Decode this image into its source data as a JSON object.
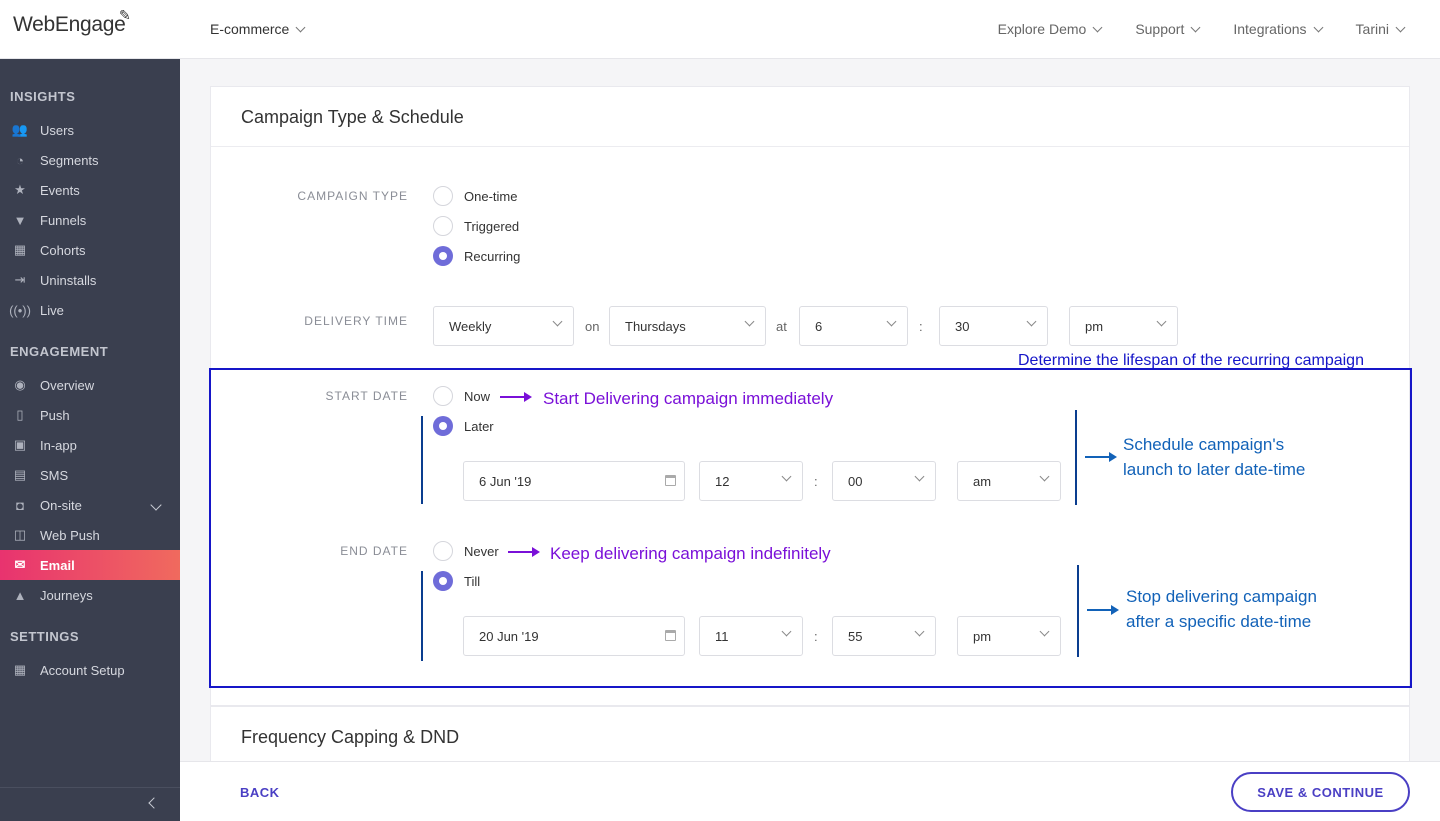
{
  "app": {
    "logo_text": "WebEngage",
    "project": "E-commerce"
  },
  "topnav": {
    "items": [
      "Explore Demo",
      "Support",
      "Integrations",
      "Tarini"
    ]
  },
  "sidebar": {
    "sections": {
      "insights": "INSIGHTS",
      "engagement": "ENGAGEMENT",
      "settings": "SETTINGS"
    },
    "items": {
      "users": "Users",
      "segments": "Segments",
      "events": "Events",
      "funnels": "Funnels",
      "cohorts": "Cohorts",
      "uninstalls": "Uninstalls",
      "live": "Live",
      "overview": "Overview",
      "push": "Push",
      "inapp": "In-app",
      "sms": "SMS",
      "onsite": "On-site",
      "webpush": "Web Push",
      "email": "Email",
      "journeys": "Journeys",
      "account": "Account Setup"
    },
    "active_item": "Email"
  },
  "card": {
    "title": "Campaign Type & Schedule",
    "campaign_type": {
      "label": "CAMPAIGN TYPE",
      "options": [
        "One-time",
        "Triggered",
        "Recurring"
      ],
      "selected": "Recurring"
    },
    "delivery_time": {
      "label": "DELIVERY TIME",
      "frequency": "Weekly",
      "on_label": "on",
      "day": "Thursdays",
      "at_label": "at",
      "hour": "6",
      "colon": ":",
      "minute": "30",
      "ampm": "pm"
    },
    "start_date": {
      "label": "START DATE",
      "now": "Now",
      "later": "Later",
      "selected": "Later",
      "date": "6 Jun '19",
      "hour": "12",
      "minute": "00",
      "ampm": "am"
    },
    "end_date": {
      "label": "END DATE",
      "never": "Never",
      "till": "Till",
      "selected": "Till",
      "date": "20 Jun '19",
      "hour": "11",
      "minute": "55",
      "ampm": "pm"
    }
  },
  "annotations": {
    "top": "Determine the lifespan of the recurring campaign",
    "now": "Start Delivering campaign immediately",
    "later_line1": "Schedule campaign's",
    "later_line2": "launch to later date-time",
    "never": "Keep delivering campaign indefinitely",
    "till_line1": "Stop delivering campaign",
    "till_line2": "after a specific date-time"
  },
  "card2": {
    "title": "Frequency Capping & DND"
  },
  "footer": {
    "back": "BACK",
    "save": "SAVE & CONTINUE"
  },
  "colors": {
    "accent": "#6f6cd9",
    "email_active": "#e8336f",
    "annotation_blue": "#1262b8",
    "annotation_purple": "#7a10d8",
    "highlight_border": "#1616c8"
  }
}
